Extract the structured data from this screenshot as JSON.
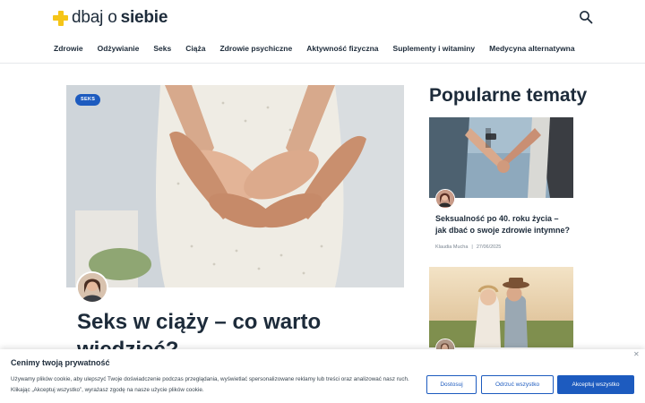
{
  "header": {
    "logo_part1": "dbaj o",
    "logo_part2": "siebie",
    "nav": [
      "Zdrowie",
      "Odżywianie",
      "Seks",
      "Ciąża",
      "Zdrowie psychiczne",
      "Aktywność fizyczna",
      "Suplementy i witaminy",
      "Medycyna alternatywna"
    ]
  },
  "hero": {
    "category": "SEKS",
    "title": "Seks w ciąży – co warto wiedzieć?"
  },
  "sidebar": {
    "title": "Popularne tematy",
    "cards": [
      {
        "title": "Seksualność po 40. roku życia – jak dbać o swoje zdrowie intymne?",
        "author": "Klaudia Mucha",
        "separator": "|",
        "date": "27/06/2025"
      }
    ]
  },
  "cookie": {
    "title": "Cenimy twoją prywatność",
    "text": "Używamy plików cookie, aby ulepszyć Twoje doświadczenie podczas przeglądania, wyświetlać spersonalizowane reklamy lub treści oraz analizować nasz ruch. Klikając „Akceptuj wszystko”, wyrażasz zgodę na nasze użycie plików cookie.",
    "close": "✕",
    "btn_customize": "Dostosuj",
    "btn_reject": "Odrzuć wszystko",
    "btn_accept": "Akceptuj wszystko"
  }
}
